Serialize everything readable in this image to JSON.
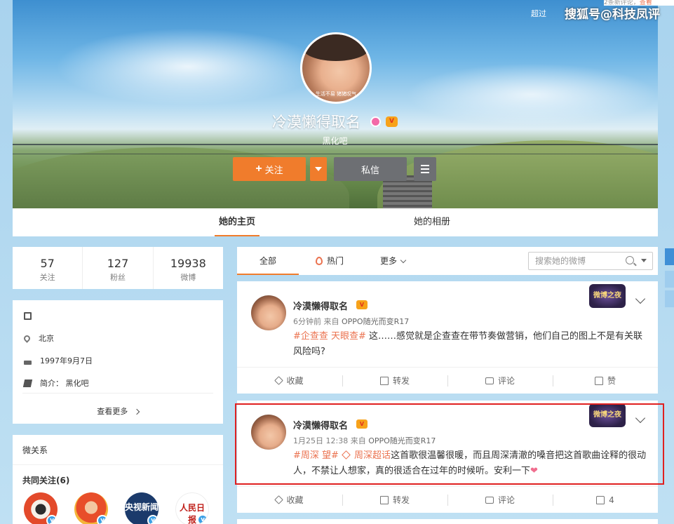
{
  "overlay": {
    "watermark": "搜狐号@科技凤评",
    "notice_count": "2条新评论，",
    "notice_link": "查看",
    "over_hint": "超过"
  },
  "profile": {
    "avatar_caption": "生活不易 猪猪叹气",
    "username": "冷漠懒得取名",
    "bio": "黑化吧",
    "follow_label": "关注",
    "message_label": "私信"
  },
  "tabs": {
    "home": "她的主页",
    "album": "她的相册"
  },
  "stats": [
    {
      "num": "57",
      "label": "关注"
    },
    {
      "num": "127",
      "label": "粉丝"
    },
    {
      "num": "19938",
      "label": "微博"
    }
  ],
  "info": {
    "location": "北京",
    "birthday": "1997年9月7日",
    "intro": "简介：  黑化吧",
    "see_more": "查看更多"
  },
  "relations": {
    "title": "微关系",
    "common_follow": "共同关注(6)",
    "accounts": [
      {
        "text": "",
        "color": "#d8452c"
      },
      {
        "text": "",
        "color": "#e04f2a"
      },
      {
        "text": "央视新闻",
        "color": "#1b3a6b"
      },
      {
        "text": "人民日报",
        "color": "#ffffff"
      }
    ]
  },
  "feed": {
    "tab_all": "全部",
    "tab_hot": "热门",
    "tab_more": "更多",
    "search_placeholder": "搜索她的微博",
    "theme_badge": "微博之夜",
    "posts": [
      {
        "name": "冷漠懒得取名",
        "time": "6分钟前",
        "from": " 来自 ",
        "source": "OPPO随光而变R17",
        "tag": "#企查查 天眼查#",
        "text": " 这……感觉就是企查查在带节奏做营销，他们自己的图上不是有关联风险吗?",
        "actions": {
          "fav": "收藏",
          "share": "转发",
          "comment": "评论",
          "like": "赞"
        }
      },
      {
        "name": "冷漠懒得取名",
        "time": "1月25日 12:38",
        "from": " 来自 ",
        "source": "OPPO随光而变R17",
        "tag": "#周深 望#",
        "tag2": " 周深超话",
        "text": "这首歌很温馨很暖，而且周深清澈的嗓音把这首歌曲诠释的很动人，不禁让人想家，真的很适合在过年的时候听。安利一下",
        "actions": {
          "fav": "收藏",
          "share": "转发",
          "comment": "评论",
          "like": "4"
        }
      }
    ]
  }
}
